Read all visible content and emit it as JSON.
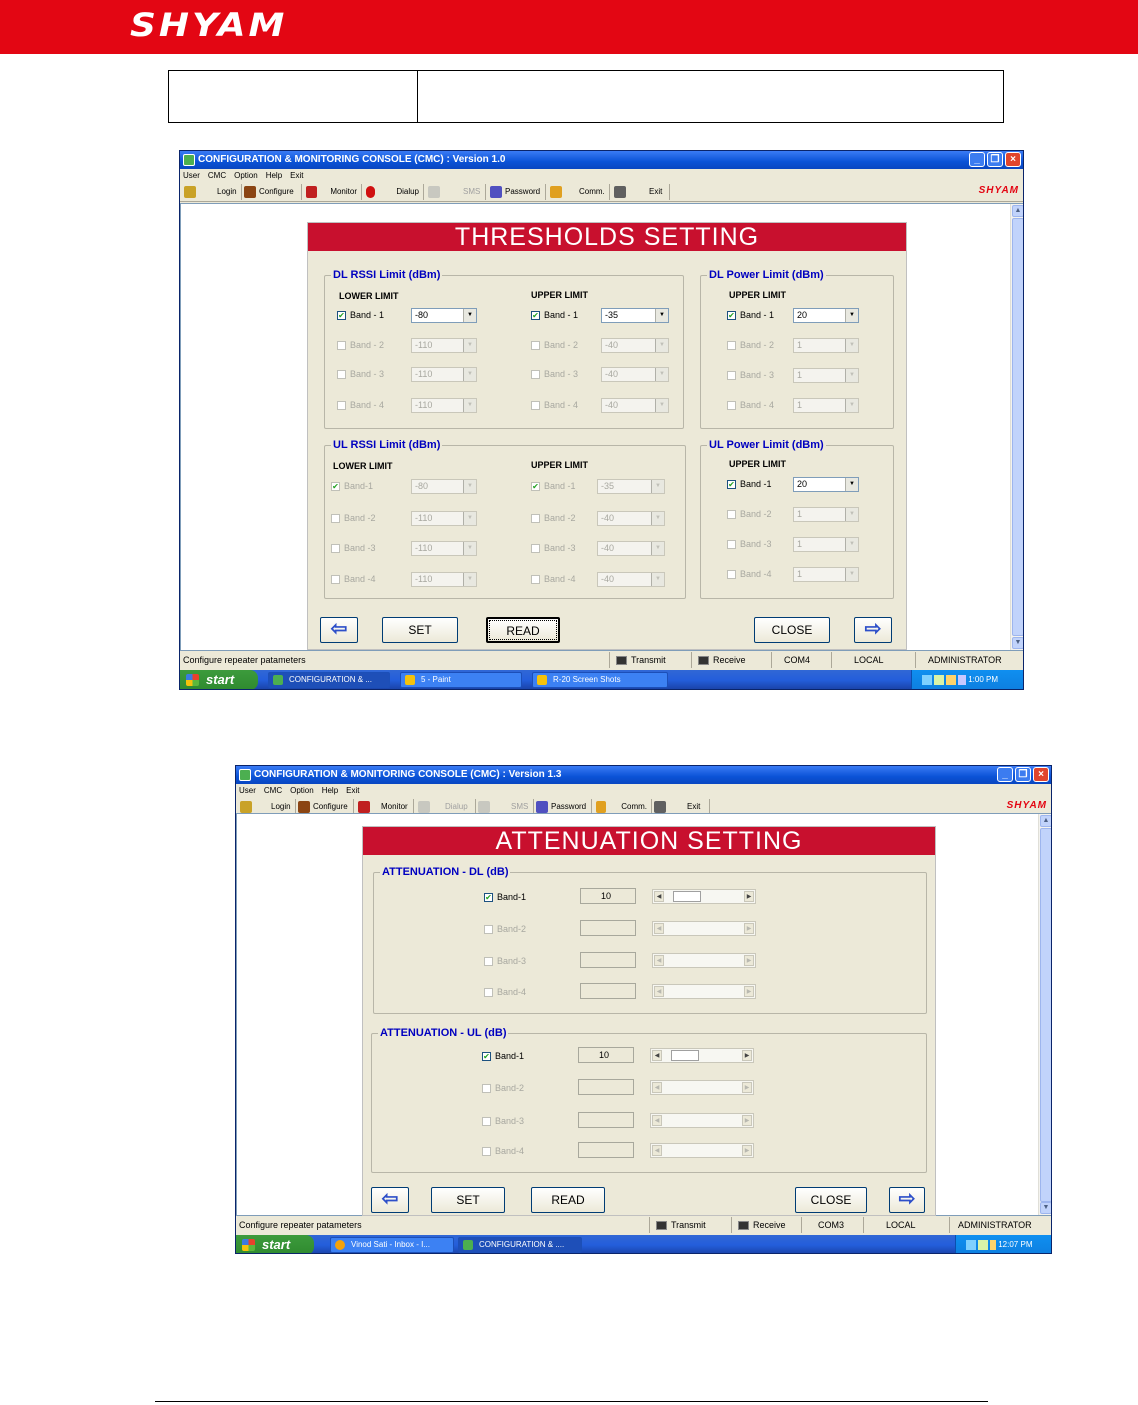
{
  "doc": {
    "logo": "SHYAM"
  },
  "window1": {
    "title": "CONFIGURATION & MONITORING CONSOLE (CMC)  :  Version 1.0",
    "menu": [
      "User",
      "CMC",
      "Option",
      "Help",
      "Exit"
    ],
    "toolbar": [
      {
        "label": "Login",
        "icon": "key-icon",
        "enabled": true
      },
      {
        "label": "Configure",
        "icon": "configure-icon",
        "enabled": true
      },
      {
        "label": "Monitor",
        "icon": "monitor-icon",
        "enabled": true
      },
      {
        "label": "Dialup",
        "icon": "phone-icon",
        "enabled": true
      },
      {
        "label": "SMS",
        "icon": "sms-icon",
        "enabled": false
      },
      {
        "label": "Password",
        "icon": "password-icon",
        "enabled": true
      },
      {
        "label": "Comm.",
        "icon": "comm-icon",
        "enabled": true
      },
      {
        "label": "Exit",
        "icon": "exit-icon",
        "enabled": true
      }
    ],
    "brand": "SHYAM",
    "form_title": "THRESHOLDS SETTING",
    "dl_rssi": {
      "label": "DL RSSI Limit (dBm)",
      "lower_head": "LOWER LIMIT",
      "upper_head": "UPPER LIMIT",
      "lower": [
        {
          "band": "Band - 1",
          "checked": true,
          "value": "-80",
          "enabled": true
        },
        {
          "band": "Band - 2",
          "checked": false,
          "value": "-110",
          "enabled": false
        },
        {
          "band": "Band - 3",
          "checked": false,
          "value": "-110",
          "enabled": false
        },
        {
          "band": "Band - 4",
          "checked": false,
          "value": "-110",
          "enabled": false
        }
      ],
      "upper": [
        {
          "band": "Band - 1",
          "checked": true,
          "value": "-35",
          "enabled": true
        },
        {
          "band": "Band - 2",
          "checked": false,
          "value": "-40",
          "enabled": false
        },
        {
          "band": "Band - 3",
          "checked": false,
          "value": "-40",
          "enabled": false
        },
        {
          "band": "Band - 4",
          "checked": false,
          "value": "-40",
          "enabled": false
        }
      ]
    },
    "dl_power": {
      "label": "DL Power Limit (dBm)",
      "upper_head": "UPPER LIMIT",
      "upper": [
        {
          "band": "Band - 1",
          "checked": true,
          "value": "20",
          "enabled": true
        },
        {
          "band": "Band - 2",
          "checked": false,
          "value": "1",
          "enabled": false
        },
        {
          "band": "Band - 3",
          "checked": false,
          "value": "1",
          "enabled": false
        },
        {
          "band": "Band - 4",
          "checked": false,
          "value": "1",
          "enabled": false
        }
      ]
    },
    "ul_rssi": {
      "label": "UL RSSI Limit (dBm)",
      "lower_head": "LOWER LIMIT",
      "upper_head": "UPPER LIMIT",
      "lower": [
        {
          "band": "Band-1",
          "checked": true,
          "value": "-80",
          "enabled": false
        },
        {
          "band": "Band -2",
          "checked": false,
          "value": "-110",
          "enabled": false
        },
        {
          "band": "Band -3",
          "checked": false,
          "value": "-110",
          "enabled": false
        },
        {
          "band": "Band -4",
          "checked": false,
          "value": "-110",
          "enabled": false
        }
      ],
      "upper": [
        {
          "band": "Band -1",
          "checked": true,
          "value": "-35",
          "enabled": false
        },
        {
          "band": "Band -2",
          "checked": false,
          "value": "-40",
          "enabled": false
        },
        {
          "band": "Band -3",
          "checked": false,
          "value": "-40",
          "enabled": false
        },
        {
          "band": "Band -4",
          "checked": false,
          "value": "-40",
          "enabled": false
        }
      ]
    },
    "ul_power": {
      "label": "UL Power Limit (dBm)",
      "upper_head": "UPPER LIMIT",
      "upper": [
        {
          "band": "Band -1",
          "checked": true,
          "value": "20",
          "enabled": true
        },
        {
          "band": "Band -2",
          "checked": false,
          "value": "1",
          "enabled": false
        },
        {
          "band": "Band -3",
          "checked": false,
          "value": "1",
          "enabled": false
        },
        {
          "band": "Band -4",
          "checked": false,
          "value": "1",
          "enabled": false
        }
      ]
    },
    "buttons": {
      "set": "SET",
      "read": "READ",
      "close": "CLOSE",
      "back": "⇦",
      "next": "⇨"
    },
    "status": {
      "message": "Configure repeater patameters",
      "transmit": "Transmit",
      "receive": "Receive",
      "port": "COM4",
      "mode": "LOCAL",
      "user": "ADMINISTRATOR"
    },
    "taskbar": {
      "start": "start",
      "tasks": [
        "CONFIGURATION & ...",
        "5 - Paint",
        "R-20 Screen Shots"
      ],
      "clock": "1:00 PM"
    }
  },
  "window2": {
    "title": "CONFIGURATION & MONITORING CONSOLE (CMC)  :  Version 1.3",
    "menu": [
      "User",
      "CMC",
      "Option",
      "Help",
      "Exit"
    ],
    "toolbar": [
      {
        "label": "Login",
        "icon": "key-icon",
        "enabled": true
      },
      {
        "label": "Configure",
        "icon": "configure-icon",
        "enabled": true
      },
      {
        "label": "Monitor",
        "icon": "monitor-icon",
        "enabled": true
      },
      {
        "label": "Dialup",
        "icon": "phone-icon",
        "enabled": false
      },
      {
        "label": "SMS",
        "icon": "sms-icon",
        "enabled": false
      },
      {
        "label": "Password",
        "icon": "password-icon",
        "enabled": true
      },
      {
        "label": "Comm.",
        "icon": "comm-icon",
        "enabled": true
      },
      {
        "label": "Exit",
        "icon": "exit-icon",
        "enabled": true
      }
    ],
    "brand": "SHYAM",
    "form_title": "ATTENUATION SETTING",
    "att_dl": {
      "label": "ATTENUATION - DL (dB)",
      "bands": [
        {
          "band": "Band-1",
          "checked": true,
          "value": "10",
          "enabled": true,
          "slider": 0.15
        },
        {
          "band": "Band-2",
          "checked": false,
          "value": "",
          "enabled": false,
          "slider": null
        },
        {
          "band": "Band-3",
          "checked": false,
          "value": "",
          "enabled": false,
          "slider": null
        },
        {
          "band": "Band-4",
          "checked": false,
          "value": "",
          "enabled": false,
          "slider": null
        }
      ]
    },
    "att_ul": {
      "label": "ATTENUATION - UL (dB)",
      "bands": [
        {
          "band": "Band-1",
          "checked": true,
          "value": "10",
          "enabled": true,
          "slider": 0.15
        },
        {
          "band": "Band-2",
          "checked": false,
          "value": "",
          "enabled": false,
          "slider": null
        },
        {
          "band": "Band-3",
          "checked": false,
          "value": "",
          "enabled": false,
          "slider": null
        },
        {
          "band": "Band-4",
          "checked": false,
          "value": "",
          "enabled": false,
          "slider": null
        }
      ]
    },
    "buttons": {
      "set": "SET",
      "read": "READ",
      "close": "CLOSE",
      "back": "⇦",
      "next": "⇨"
    },
    "status": {
      "message": "Configure repeater patameters",
      "transmit": "Transmit",
      "receive": "Receive",
      "port": "COM3",
      "mode": "LOCAL",
      "user": "ADMINISTRATOR"
    },
    "taskbar": {
      "start": "start",
      "tasks": [
        "Vinod Sati - Inbox - I...",
        "CONFIGURATION & ...."
      ],
      "clock": "12:07 PM"
    }
  }
}
